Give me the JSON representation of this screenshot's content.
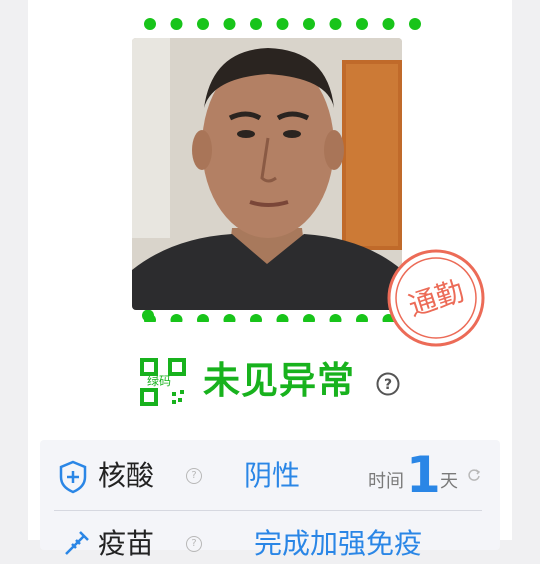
{
  "photo": {
    "frame_color": "#18c41a",
    "alt": "头像"
  },
  "stamp": {
    "text": "通勤",
    "color": "#ec6b57"
  },
  "status": {
    "qr_label": "绿码",
    "text": "未见异常",
    "help": "?",
    "color": "#18b21d"
  },
  "acid": {
    "label": "核酸",
    "help": "?",
    "result": "阴性",
    "time_label": "时间",
    "time_value": "1",
    "time_unit": "天"
  },
  "vaccine": {
    "label": "疫苗",
    "help": "?",
    "result": "完成加强免疫"
  },
  "colors": {
    "accent_blue": "#2a86e6",
    "green": "#18b21d"
  }
}
